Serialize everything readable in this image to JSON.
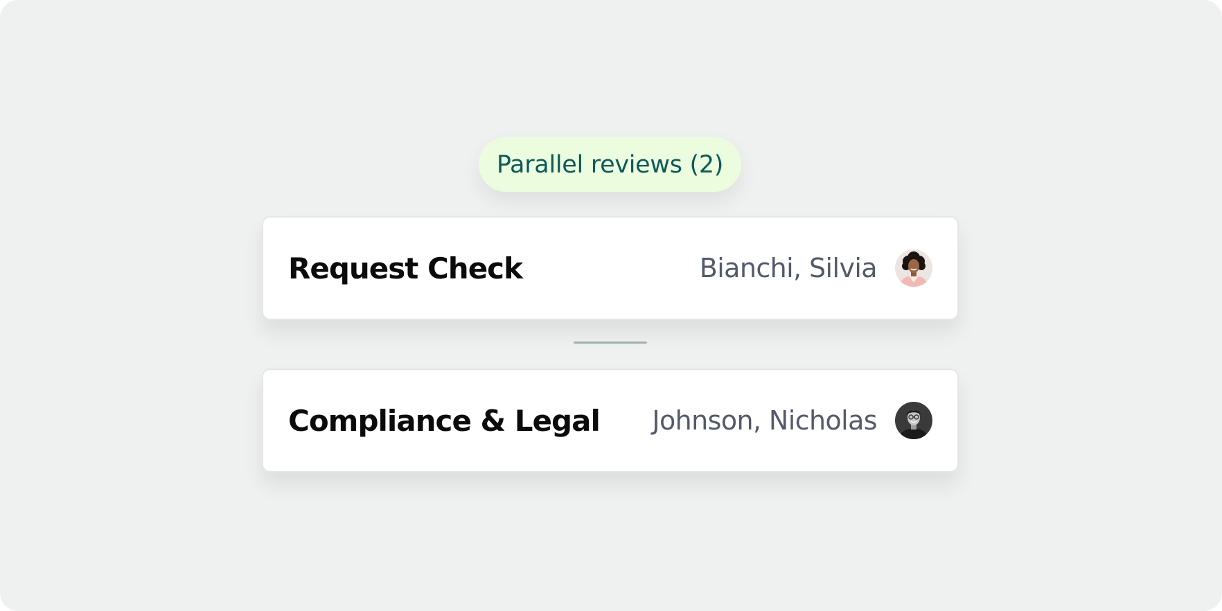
{
  "badge": {
    "label": "Parallel reviews (2)",
    "background": "#ecfcdf",
    "text_color": "#0d5a5a"
  },
  "reviews": [
    {
      "title": "Request Check",
      "assignee": "Bianchi, Silvia",
      "avatar_icon": "woman-avatar-icon"
    },
    {
      "title": "Compliance & Legal",
      "assignee": "Johnson, Nicholas",
      "avatar_icon": "man-avatar-icon"
    }
  ],
  "colors": {
    "background": "#eff1f0",
    "card": "#ffffff",
    "connector": "#9fb0ae",
    "title": "#0b0b0b",
    "assignee": "#535a6b"
  }
}
